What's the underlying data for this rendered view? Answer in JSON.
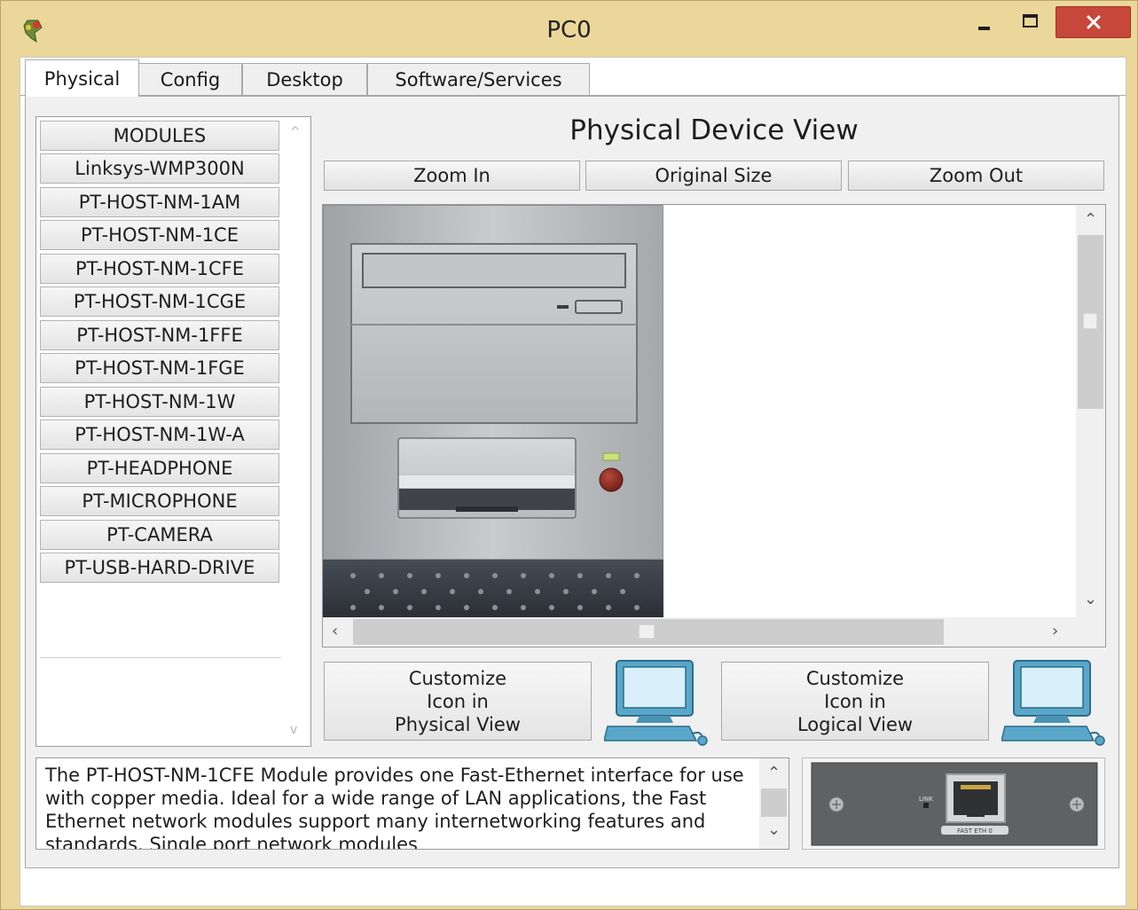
{
  "window": {
    "title": "PC0",
    "accent_color": "#ebd79a",
    "close_color": "#c7483b",
    "icons": {
      "app": "packet-tracer-app-icon",
      "minimize": "minimize-icon",
      "maximize": "maximize-icon",
      "close": "close-icon"
    }
  },
  "tabs": [
    {
      "label": "Physical",
      "active": true
    },
    {
      "label": "Config",
      "active": false
    },
    {
      "label": "Desktop",
      "active": false
    },
    {
      "label": "Software/Services",
      "active": false
    }
  ],
  "modules": {
    "header": "MODULES",
    "items": [
      "Linksys-WMP300N",
      "PT-HOST-NM-1AM",
      "PT-HOST-NM-1CE",
      "PT-HOST-NM-1CFE",
      "PT-HOST-NM-1CGE",
      "PT-HOST-NM-1FFE",
      "PT-HOST-NM-1FGE",
      "PT-HOST-NM-1W",
      "PT-HOST-NM-1W-A",
      "PT-HEADPHONE",
      "PT-MICROPHONE",
      "PT-CAMERA",
      "PT-USB-HARD-DRIVE"
    ]
  },
  "device_view": {
    "title": "Physical Device View",
    "zoom_in": "Zoom In",
    "original_size": "Original Size",
    "zoom_out": "Zoom Out",
    "power_led_color": "#c9e27a",
    "power_button_color": "#8a2a22"
  },
  "customize": {
    "physical": {
      "line1": "Customize",
      "line2": "Icon in",
      "line3": "Physical View"
    },
    "logical": {
      "line1": "Customize",
      "line2": "Icon in",
      "line3": "Logical View"
    },
    "icon": "pc-computer-icon"
  },
  "description": {
    "text": "The PT-HOST-NM-1CFE Module provides one Fast-Ethernet interface for use with copper media. Ideal for a wide range of LAN applications, the Fast Ethernet network modules support many internetworking features and standards. Single port network modules"
  },
  "module_preview": {
    "link_label": "LINK",
    "port_label": "FAST ETH 0",
    "icons": [
      "screw-icon",
      "ethernet-port-icon"
    ]
  }
}
